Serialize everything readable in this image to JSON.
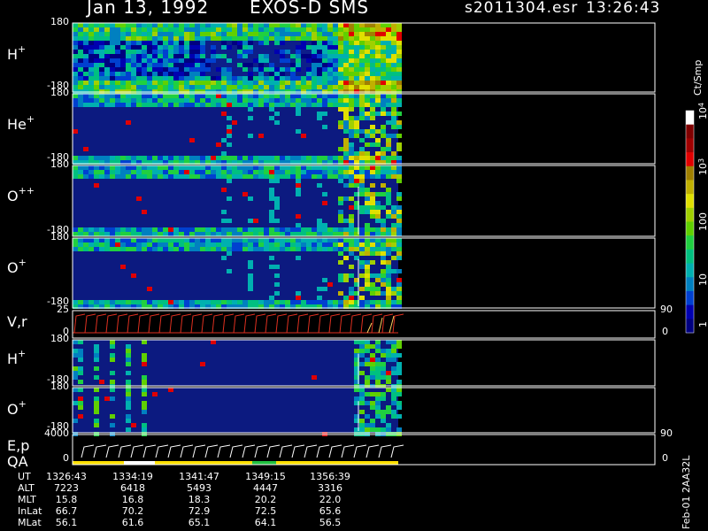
{
  "header": {
    "date": "Jan 13, 1992",
    "mission": "EXOS-D SMS",
    "file": "s2011304.esr",
    "time": "13:26:43"
  },
  "chart_data": {
    "type": "heatmap",
    "panels": [
      {
        "label_base": "H",
        "label_sup": "+",
        "ylim": [
          -180,
          180
        ],
        "y_ticks": [
          "180",
          "-180"
        ]
      },
      {
        "label_base": "He",
        "label_sup": "+",
        "ylim": [
          -180,
          180
        ],
        "y_ticks": [
          "180",
          "-180"
        ]
      },
      {
        "label_base": "O",
        "label_sup": "++",
        "ylim": [
          -180,
          180
        ],
        "y_ticks": [
          "180",
          "-180"
        ]
      },
      {
        "label_base": "O",
        "label_sup": "+",
        "ylim": [
          -180,
          180
        ],
        "y_ticks": [
          "180",
          "-180"
        ]
      },
      {
        "label_base": "V,r",
        "label_sup": "",
        "ylim": [
          0,
          25
        ],
        "y_ticks": [
          "25",
          "0"
        ],
        "right_ticks": [
          "90",
          "0"
        ]
      },
      {
        "label_base": "H",
        "label_sup": "+",
        "ylim": [
          -180,
          180
        ],
        "y_ticks": [
          "180",
          "-180"
        ]
      },
      {
        "label_base": "O",
        "label_sup": "+",
        "ylim": [
          -180,
          180
        ],
        "y_ticks": [
          "180",
          "-180"
        ]
      },
      {
        "label_base": "E,p",
        "label_sup": "",
        "ylim": [
          0,
          4000
        ],
        "y_ticks": [
          "4000",
          "0"
        ],
        "right_ticks": [
          "90",
          "0"
        ],
        "sub_label": "QA"
      }
    ],
    "colorbar": {
      "unit": "Ct/Smp",
      "ticks": [
        {
          "base": "10",
          "exp": "4",
          "frac": 0.0
        },
        {
          "base": "10",
          "exp": "3",
          "frac": 0.25
        },
        {
          "base": "100",
          "exp": "",
          "frac": 0.5
        },
        {
          "base": "10",
          "exp": "",
          "frac": 0.75
        },
        {
          "base": "1",
          "exp": "",
          "frac": 1.0
        }
      ],
      "colors": [
        "#000080",
        "#0000b0",
        "#0040d0",
        "#0080c0",
        "#00b0b0",
        "#00c080",
        "#20d040",
        "#60d000",
        "#a0d000",
        "#e0e000",
        "#c0b000",
        "#a08000",
        "#e00000",
        "#a00000",
        "#800000",
        "#ffffff"
      ]
    },
    "ephemeris": {
      "rows": [
        {
          "label": "UT",
          "values": [
            "1326:43",
            "1334:19",
            "1341:47",
            "1349:15",
            "1356:39"
          ]
        },
        {
          "label": "ALT",
          "values": [
            "7223",
            "6418",
            "5493",
            "4447",
            "3316"
          ]
        },
        {
          "label": "MLT",
          "values": [
            "15.8",
            "16.8",
            "18.3",
            "20.2",
            "22.0"
          ]
        },
        {
          "label": "InLat",
          "values": [
            "66.7",
            "70.2",
            "72.9",
            "72.5",
            "65.6"
          ]
        },
        {
          "label": "MLat",
          "values": [
            "56.1",
            "61.6",
            "65.1",
            "64.1",
            "56.5"
          ]
        }
      ]
    },
    "footer": "Feb-01 2AA32L"
  }
}
